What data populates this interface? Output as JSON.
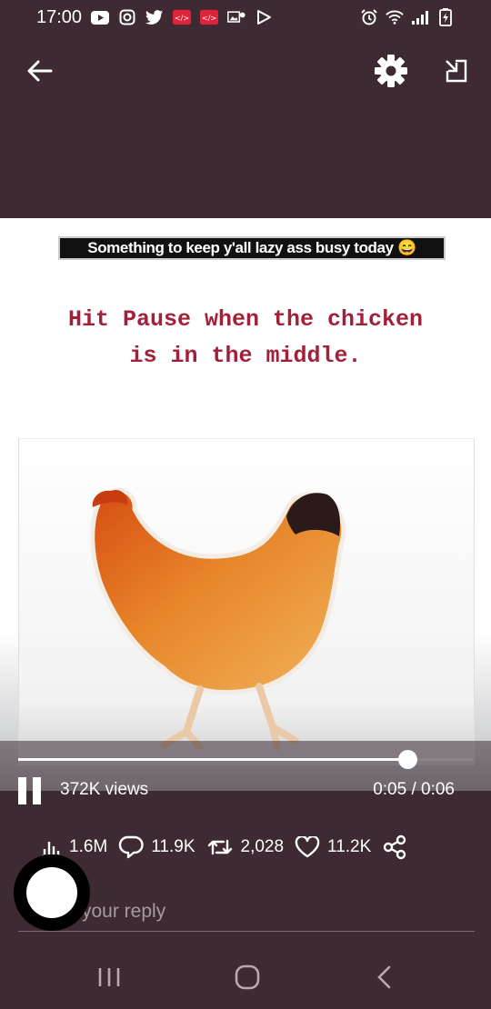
{
  "status_bar": {
    "time": "17:00",
    "left_icons": [
      "youtube-icon",
      "instagram-icon",
      "twitter-icon",
      "app-red-icon",
      "app-red-icon",
      "gallery-icon",
      "play-store-icon"
    ],
    "right_icons": [
      "alarm-icon",
      "wifi-icon",
      "signal-icon",
      "battery-icon"
    ]
  },
  "toolbar": {
    "back_icon": "arrow-left-icon",
    "settings_icon": "gear-icon",
    "exit_icon": "exit-fullscreen-icon"
  },
  "video": {
    "caption": "Something to keep y'all lazy ass busy today 😄",
    "headline_line1": "Hit Pause when the chicken",
    "headline_line2": "is in the middle.",
    "progress_fraction": 0.855,
    "views": "372K views",
    "time": "0:05 / 0:06"
  },
  "actions": {
    "views_count": "1.6M",
    "replies_count": "11.9K",
    "retweets_count": "2,028",
    "likes_count": "11.2K"
  },
  "reply": {
    "placeholder": "your reply"
  },
  "colors": {
    "background": "#3e2a33",
    "headline": "#a2213a",
    "chicken_orange": "#e07a1f"
  }
}
